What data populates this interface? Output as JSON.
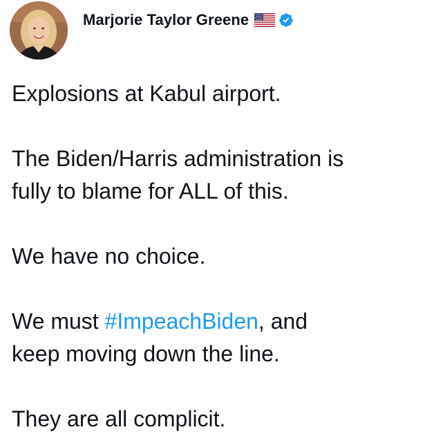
{
  "author": {
    "name": "Marjorie Taylor Greene",
    "flag_icon": "us-flag-icon",
    "verified_icon": "verified-badge-icon",
    "verified_color": "#1d9bf0"
  },
  "tweet": {
    "line1": "Explosions at Kabul airport.",
    "line2": "The Biden/Harris administration is",
    "line3": "fully to blame for ALL of this.",
    "line4": "We have no choice.",
    "line5_before": "We must ",
    "hashtag": "#ImpeachBiden",
    "line5_after": ", and",
    "line6": "keep moving down the line.",
    "line7": "They are all complicit."
  },
  "colors": {
    "text": "#0f1419",
    "link": "#1d9bf0"
  }
}
